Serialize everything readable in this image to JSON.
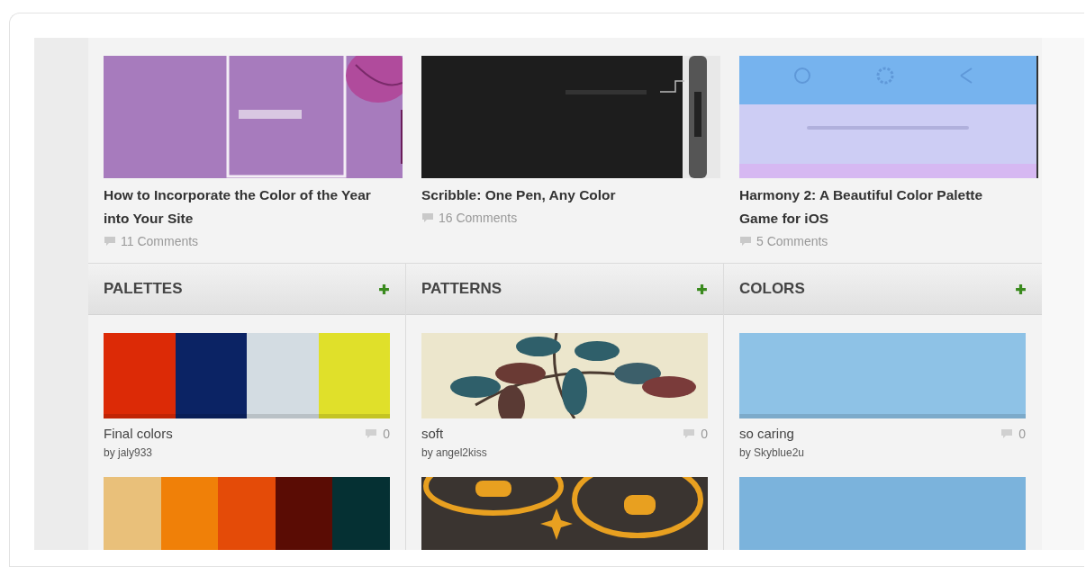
{
  "articles": [
    {
      "title": "How to Incorporate the Color of the Year into Your Site",
      "comments": "11 Comments"
    },
    {
      "title": "Scribble: One Pen, Any Color",
      "comments": "16 Comments"
    },
    {
      "title": "Harmony 2: A Beautiful Color Palette Game for iOS",
      "comments": "5 Comments"
    }
  ],
  "sections": [
    {
      "title": "PALETTES",
      "kind": "palette",
      "items": [
        {
          "name": "Final colors",
          "author": "by jaly933",
          "comments": "0",
          "swatches": [
            {
              "color": "#dc2a06"
            },
            {
              "color": "#0b2364"
            },
            {
              "color": "#d3dce2"
            },
            {
              "color": "#e0e02a"
            }
          ]
        },
        {
          "swatches": [
            {
              "color": "#e9c07a"
            },
            {
              "color": "#f08008"
            },
            {
              "color": "#e44b08"
            },
            {
              "color": "#5a0c04"
            },
            {
              "color": "#053033"
            }
          ]
        }
      ]
    },
    {
      "title": "PATTERNS",
      "kind": "pattern",
      "items": [
        {
          "name": "soft",
          "author": "by angel2kiss",
          "comments": "0",
          "kind": "picture"
        },
        {
          "kind": "picture"
        }
      ]
    },
    {
      "title": "COLORS",
      "kind": "color",
      "items": [
        {
          "name": "so caring",
          "author": "by Skyblue2u",
          "comments": "0",
          "color": "#8ec2e6"
        },
        {
          "color": "#7bb3dc"
        }
      ]
    }
  ]
}
